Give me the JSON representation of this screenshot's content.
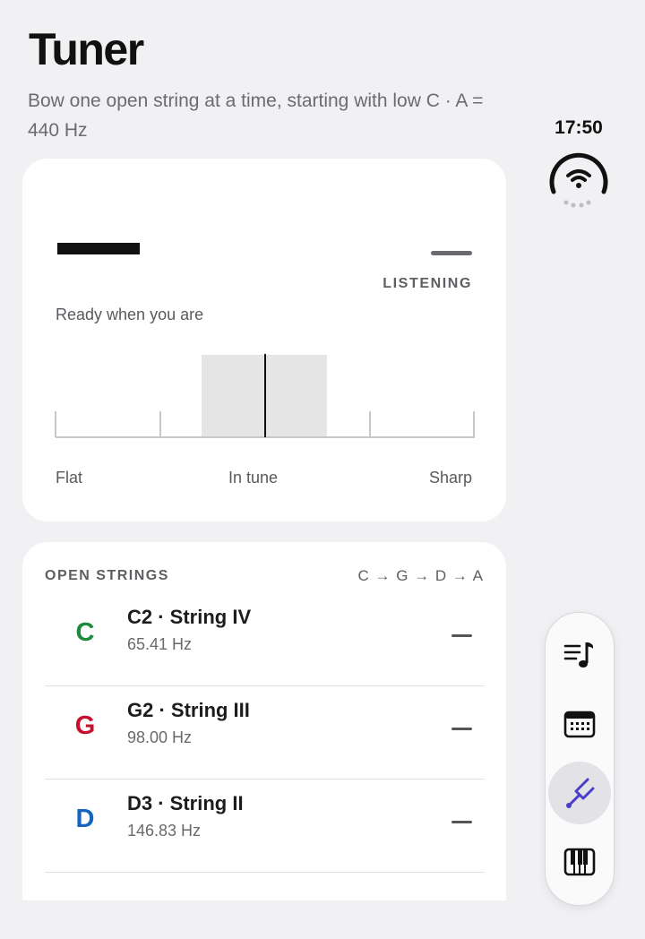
{
  "header": {
    "title": "Tuner",
    "subtitle": "Bow one open string at a time, starting with low C · A = 440 Hz"
  },
  "status": {
    "time": "17:50",
    "connection_icon": "wifi-icon"
  },
  "tuner": {
    "state": "LISTENING",
    "hint": "Ready when you are",
    "scale": {
      "flat": "Flat",
      "in_tune": "In tune",
      "sharp": "Sharp"
    }
  },
  "open_strings": {
    "heading": "OPEN STRINGS",
    "order": "C → G → D → A",
    "items": [
      {
        "letter": "C",
        "name": "C2 · String IV",
        "freq": "65.41 Hz",
        "color": "#1e8a3e"
      },
      {
        "letter": "G",
        "name": "G2 · String III",
        "freq": "98.00 Hz",
        "color": "#c8102e"
      },
      {
        "letter": "D",
        "name": "D3 · String II",
        "freq": "146.83 Hz",
        "color": "#1565c0"
      }
    ]
  },
  "nav": {
    "items": [
      {
        "icon": "music-list-icon",
        "active": false
      },
      {
        "icon": "calendar-icon",
        "active": false
      },
      {
        "icon": "tuning-fork-icon",
        "active": true
      },
      {
        "icon": "piano-icon",
        "active": false
      }
    ],
    "accent": "#4a3fc7"
  }
}
